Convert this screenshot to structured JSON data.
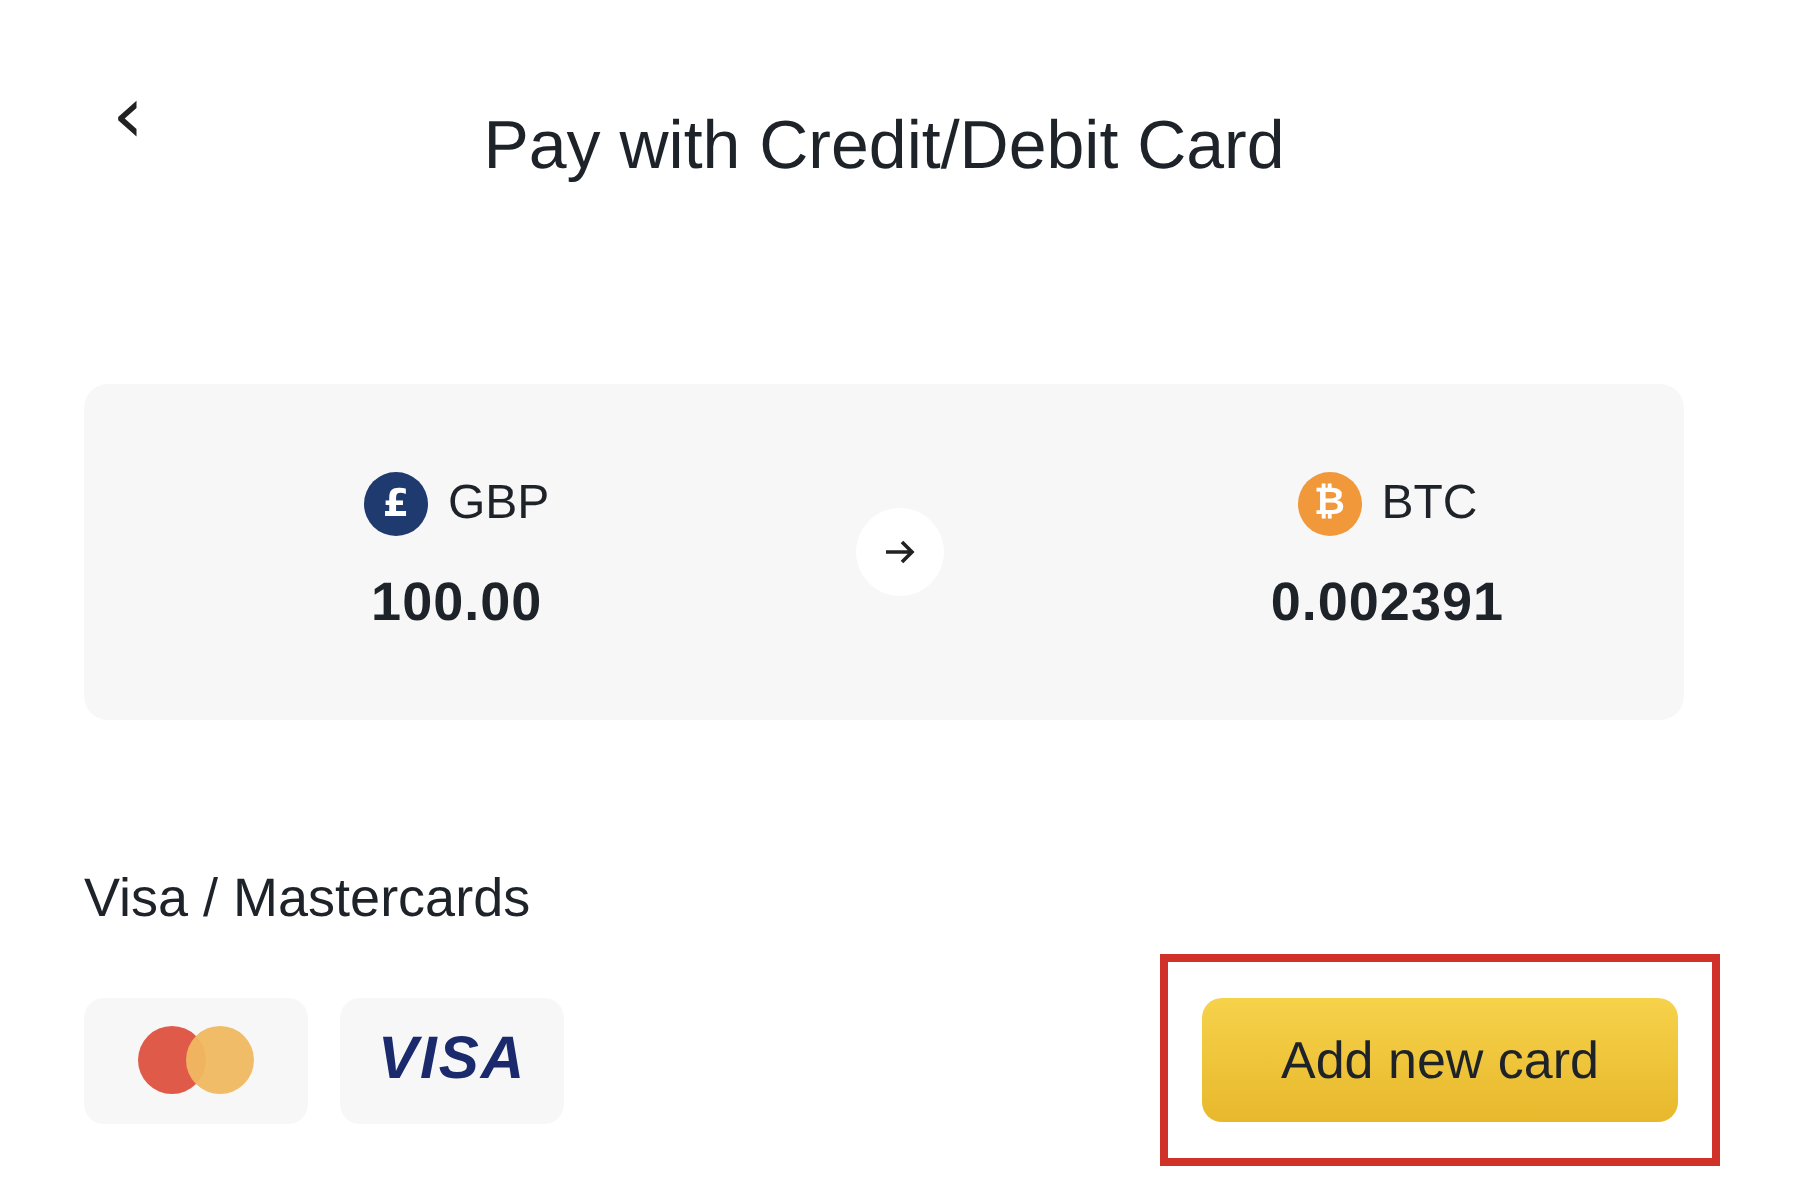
{
  "header": {
    "back_icon": "‹",
    "title": "Pay with Credit/Debit Card"
  },
  "conversion": {
    "from": {
      "symbol": "£",
      "code": "GBP",
      "amount": "100.00",
      "color": "#1e3a6e"
    },
    "to": {
      "symbol": "₿",
      "code": "BTC",
      "amount": "0.002391",
      "color": "#f0983a"
    }
  },
  "payment": {
    "heading": "Visa / Mastercards",
    "cards": [
      {
        "kind": "mastercard"
      },
      {
        "kind": "visa",
        "label": "VISA"
      }
    ],
    "button": {
      "label": "Add new card",
      "highlighted": true
    }
  }
}
